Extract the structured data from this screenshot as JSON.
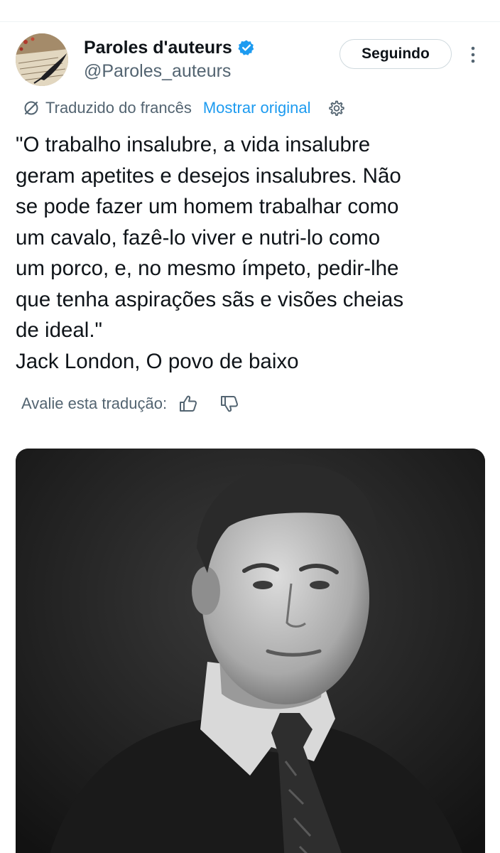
{
  "author": {
    "display_name": "Paroles d'auteurs",
    "handle": "@Paroles_auteurs",
    "verified": true,
    "avatar_icon": "avatar-quill-paper-icon"
  },
  "follow_button": {
    "label": "Seguindo"
  },
  "translation": {
    "label": "Traduzido do francês",
    "show_original": "Mostrar original"
  },
  "tweet": {
    "lines": [
      "\"O trabalho insalubre, a vida insalubre",
      "geram apetites e desejos insalubres. Não",
      "se pode fazer um homem trabalhar como",
      "um cavalo, fazê-lo viver e nutri-lo como",
      "um porco, e, no mesmo ímpeto, pedir-lhe",
      "que tenha aspirações sãs e visões cheias",
      "de ideal.\"",
      "Jack London, O povo de baixo"
    ]
  },
  "rate": {
    "label": "Avalie esta tradução:"
  },
  "media": {
    "icon": "portrait-photo"
  },
  "colors": {
    "text_primary": "#0f1419",
    "text_secondary": "#536471",
    "link": "#1d9bf0",
    "border": "#cfd9de"
  }
}
